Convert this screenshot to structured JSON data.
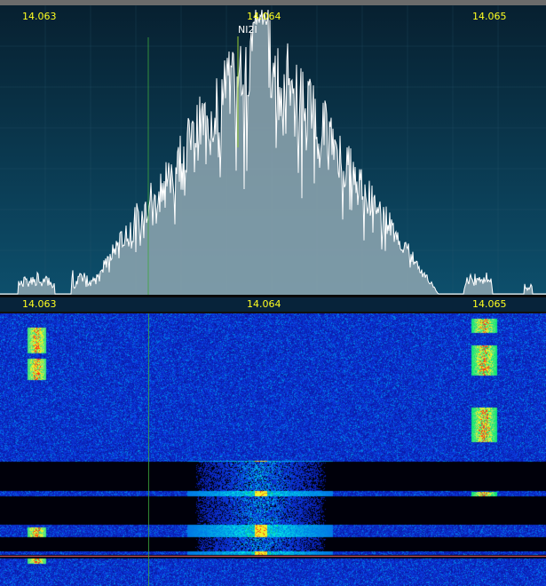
{
  "spectrum": {
    "freq_labels": [
      "14.063",
      "14.064",
      "14.065"
    ],
    "spot_label": "NI2I"
  },
  "ruler": {
    "freq_labels": [
      "14.063",
      "14.064",
      "14.065"
    ]
  },
  "colors": {
    "freq_label": "#ffff20",
    "spectrum_bg_top": "#072030",
    "spectrum_bg_bottom": "#0d4f6c",
    "spectrum_trace": "#ffffff",
    "spectrum_fill": "#8fa7b2",
    "waterfall_noise": "#0a24c8",
    "marker_line": "#3ca83c"
  }
}
